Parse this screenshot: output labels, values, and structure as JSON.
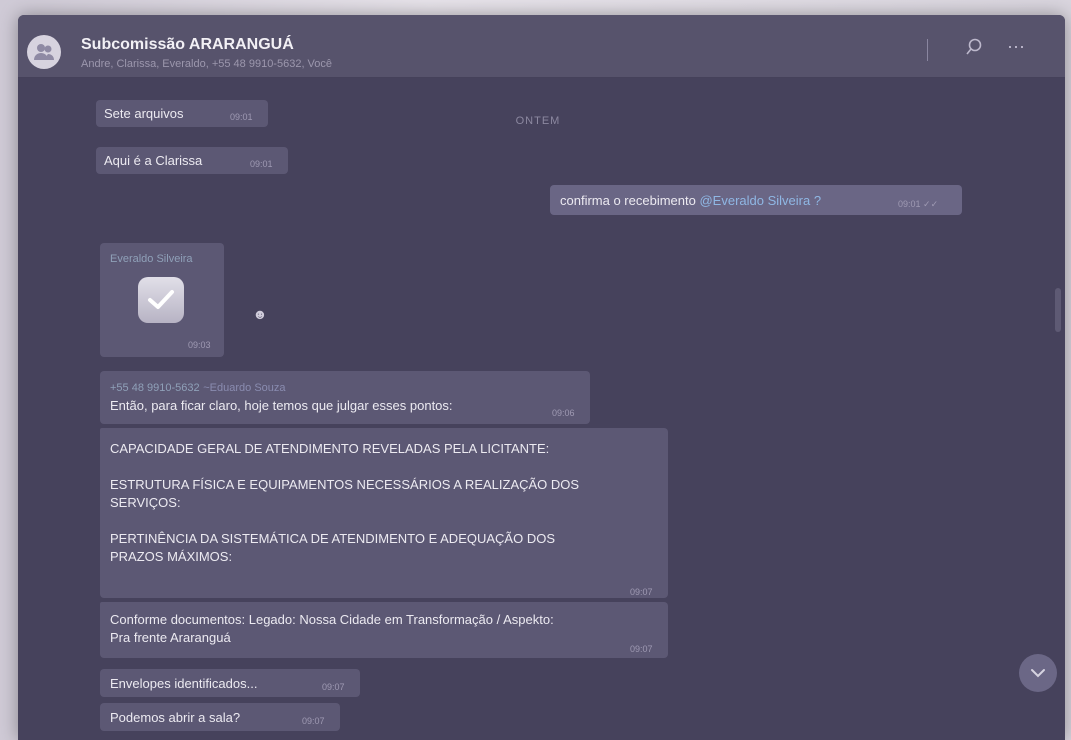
{
  "chat": {
    "title": "Subcomissão ARARANGUÁ",
    "members": "Andre, Clarissa, Everaldo, +55 48 9910-5632, Você",
    "date_divider": "ONTEM"
  },
  "messages": [
    {
      "text": "Sete arquivos",
      "time": "09:01"
    },
    {
      "text": "Aqui é a Clarissa",
      "time": "09:01"
    },
    {
      "text_prefix": "confirma o recebimento",
      "mention": "@Everaldo Silveira ?",
      "time": "09:01 ✓✓"
    },
    {
      "sender": "Everaldo Silveira",
      "time": "09:03"
    },
    {
      "sender": "+55 48 9910-5632",
      "sender_name": "~Eduardo Souza",
      "text": "Então, para ficar claro, hoje temos que julgar esses pontos:",
      "time": "09:06"
    },
    {
      "lines": [
        "CAPACIDADE GERAL DE ATENDIMENTO REVELADAS PELA LICITANTE:",
        "ESTRUTURA FÍSICA E EQUIPAMENTOS NECESSÁRIOS A REALIZAÇÃO DOS",
        "SERVIÇOS:",
        "PERTINÊNCIA DA SISTEMÁTICA DE ATENDIMENTO E ADEQUAÇÃO DOS",
        "PRAZOS MÁXIMOS:"
      ],
      "time": "09:07"
    },
    {
      "lines": [
        "Conforme documentos: Legado: Nossa Cidade em Transformação / Aspekto:",
        "Pra frente Araranguá"
      ],
      "time": "09:07"
    },
    {
      "text": "Envelopes identificados...",
      "time": "09:07"
    },
    {
      "text": "Podemos abrir a sala?",
      "time": "09:07"
    }
  ],
  "icons": {
    "avatar": "group-avatar-icon",
    "search": "search-icon",
    "more": "more-options-icon",
    "reaction": "emoji-icon",
    "scroll_down": "chevron-down-icon"
  }
}
